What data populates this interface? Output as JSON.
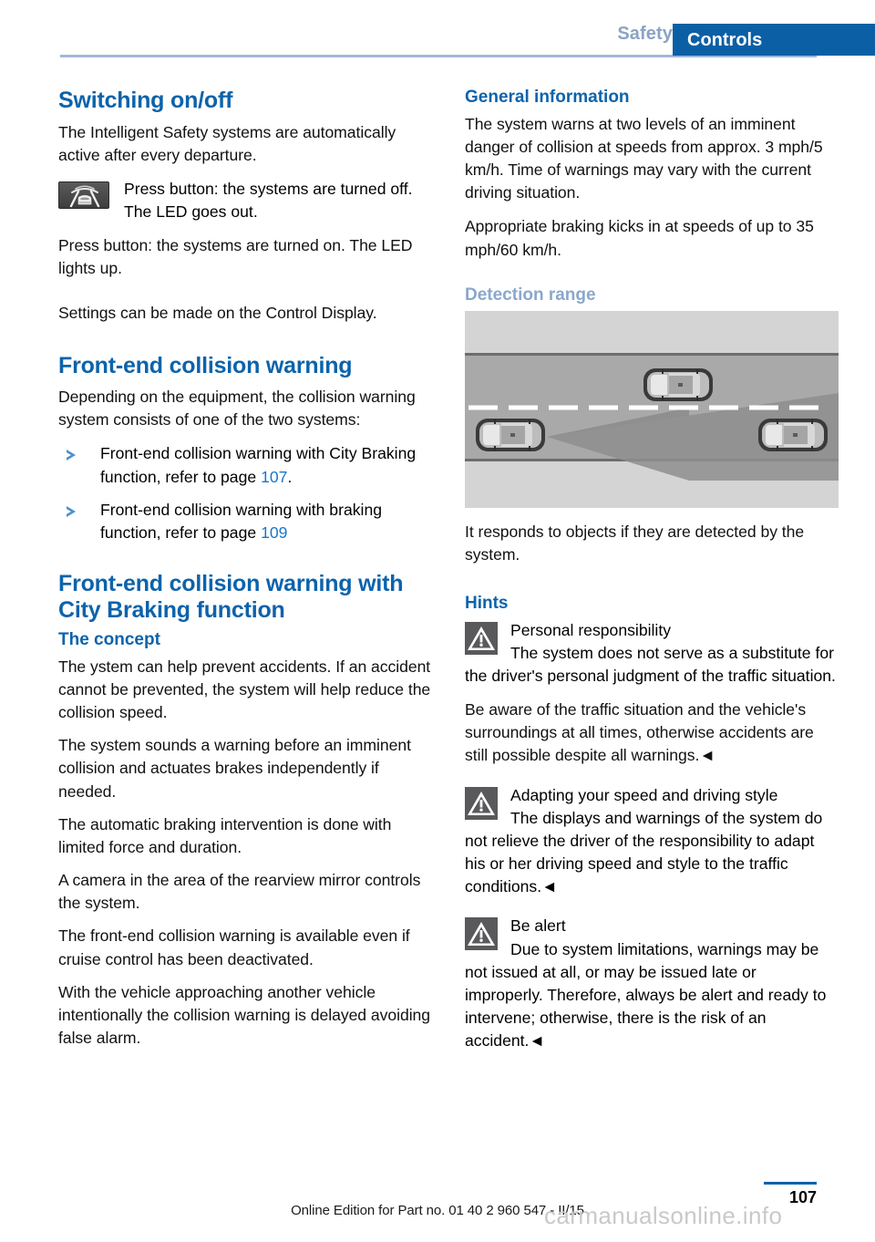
{
  "header": {
    "secondary_tab": "Safety",
    "primary_tab": "Controls",
    "accent_blue": "#0b5fa5",
    "muted_blue": "#8ba3c4"
  },
  "left_column": {
    "heading_switching": "Switching on/off",
    "p_intro": "The Intelligent Safety systems are automatically active after every departure.",
    "p_button_off": "Press button: the systems are turned off. The LED goes out.",
    "p_button_on": "Press button: the systems are turned on. The LED lights up.",
    "p_settings": "Settings can be made on the Control Display.",
    "heading_frontend": "Front-end collision warning",
    "p_depending": "Depending on the equipment, the collision warning system consists of one of the two systems:",
    "bullets": [
      {
        "text_before": "Front-end collision warning with City Braking function, refer to page ",
        "page_ref": "107",
        "text_after": "."
      },
      {
        "text_before": "Front-end collision warning with braking function, refer to page ",
        "page_ref": "109",
        "text_after": ""
      }
    ],
    "heading_frontend_city": "Front-end collision warning with City Braking function",
    "subheading_concept": "The concept",
    "p_concept_1": "The ystem can help prevent accidents. If an accident cannot be prevented, the system will help reduce the collision speed.",
    "p_concept_2": "The system sounds a warning before an imminent collision and actuates brakes independently if needed.",
    "p_concept_3": "The automatic braking intervention is done with limited force and duration.",
    "p_concept_4": "A camera in the area of the rearview mirror controls the system.",
    "p_concept_5": "The front-end collision warning is available even if cruise control has been deactivated.",
    "p_concept_6": "With the vehicle approaching another vehicle intentionally the collision warning is delayed avoiding false alarm."
  },
  "right_column": {
    "heading_general": "General information",
    "p_general_1": "The system warns at two levels of an imminent danger of collision at speeds from approx. 3 mph/5 km/h. Time of warnings may vary with the current driving situation.",
    "p_general_2": "Appropriate braking kicks in at speeds of up to 35 mph/60 km/h.",
    "subheading_detection": "Detection range",
    "p_responds": "It responds to objects if they are detected by the system.",
    "subheading_hints": "Hints",
    "warnings": [
      {
        "title": "Personal responsibility",
        "body_first": "The system does not serve as a substitute for the driver's personal judgment of the traffic situation.",
        "body_second": "Be aware of the traffic situation and the vehicle's surroundings at all times, otherwise accidents are still possible despite all warnings.◄"
      },
      {
        "title": "Adapting your speed and driving style",
        "body_first": "The displays and warnings of the system do not relieve the driver of the responsibility to adapt his or her driving speed and style to the traffic conditions.◄",
        "body_second": ""
      },
      {
        "title": "Be alert",
        "body_first": "Due to system limitations, warnings may be not issued at all, or may be issued late or improperly. Therefore, always be alert and ready to intervene; otherwise, there is the risk of an accident.◄",
        "body_second": ""
      }
    ],
    "figure_alt": "detection-range-diagram"
  },
  "footer": {
    "edition_text": "Online Edition for Part no. 01 40 2 960 547 - II/15",
    "page_number": "107",
    "watermark": "carmanualsonline.info"
  }
}
